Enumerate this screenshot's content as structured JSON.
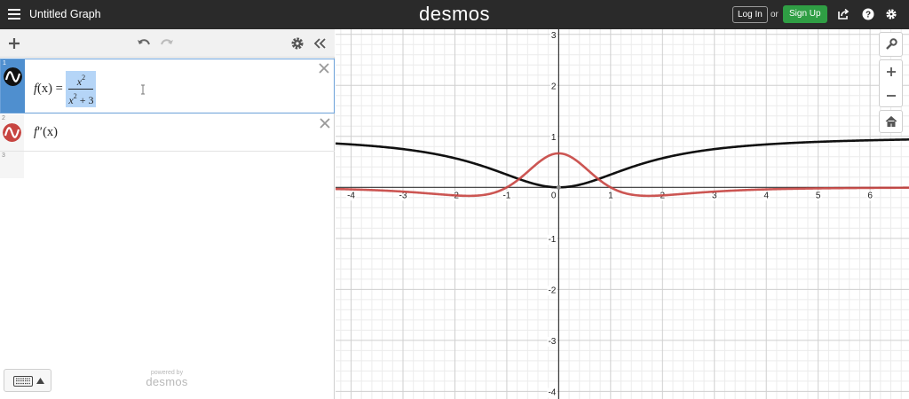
{
  "topbar": {
    "title": "Untitled Graph",
    "brand": "desmos",
    "login_label": "Log In",
    "or_text": "or",
    "signup_label": "Sign Up"
  },
  "expressions": [
    {
      "number": "1",
      "color": "#111111"
    },
    {
      "number": "2",
      "color": "#c74440"
    },
    {
      "number": "3"
    }
  ],
  "math": {
    "fx_lhs": "f",
    "fx_arg": "(x) =",
    "fx_num_base": "x",
    "fx_num_exp": "2",
    "fx_den_base": "x",
    "fx_den_exp": "2",
    "fx_den_rest": "+ 3",
    "fpp_lhs": "f",
    "fpp_prime": "″",
    "fpp_arg": "(x)"
  },
  "footer": {
    "powered_by": "powered by",
    "brand": "desmos"
  },
  "chart_data": {
    "type": "line",
    "xlim": [
      -4.3,
      6.75
    ],
    "ylim": [
      -4.15,
      3.1
    ],
    "grid": true,
    "x_ticks": [
      "-4",
      "-3",
      "-2",
      "-1",
      "1",
      "2",
      "3",
      "4",
      "5",
      "6"
    ],
    "y_ticks": [
      "-4",
      "-3",
      "-2",
      "-1",
      "1",
      "2",
      "3"
    ],
    "origin_label": "0",
    "series": [
      {
        "color": "#111111",
        "formula": "x^2/(x^2+3)"
      },
      {
        "color": "#c74440",
        "formula": "(18-18x^2)/(x^2+3)^3"
      }
    ]
  }
}
